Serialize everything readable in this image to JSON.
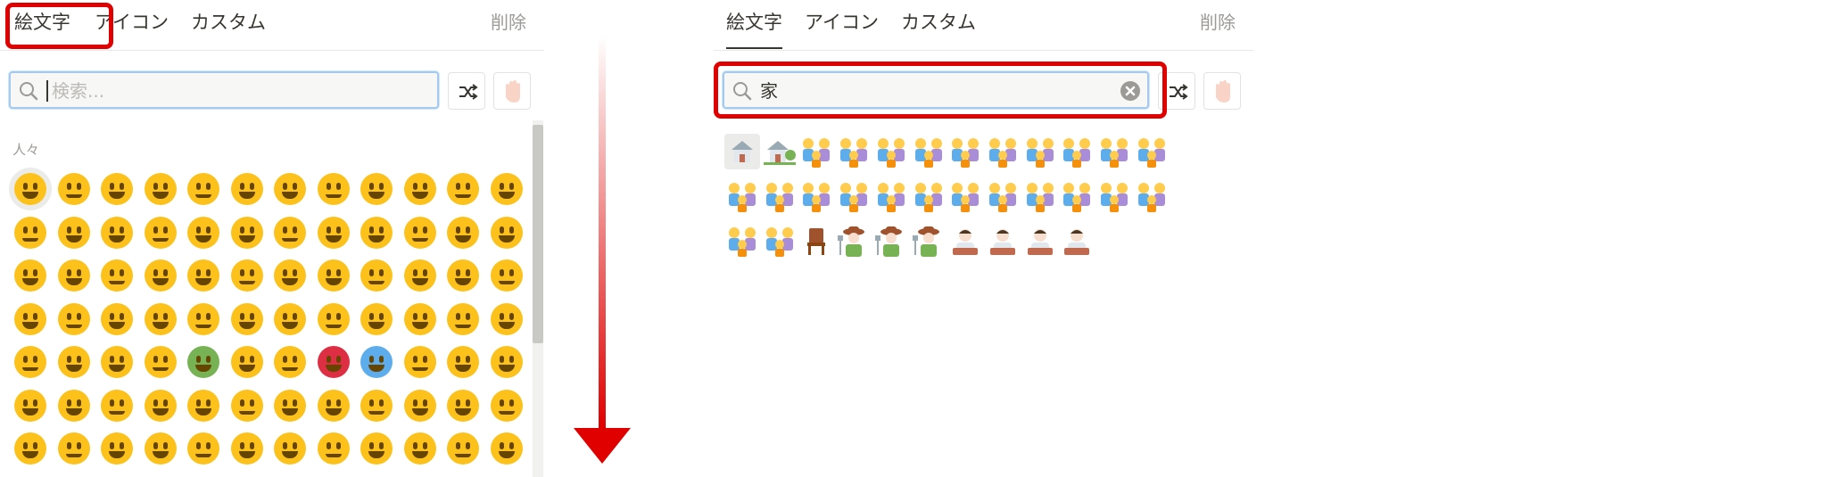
{
  "left": {
    "tabs": [
      {
        "label": "絵文字",
        "active": true
      },
      {
        "label": "アイコン",
        "active": false
      },
      {
        "label": "カスタム",
        "active": false
      }
    ],
    "remove_label": "削除",
    "search_placeholder": "検索...",
    "section_label": "人々",
    "emoji_rows": 7,
    "emoji_cols": 12
  },
  "right": {
    "tabs": [
      {
        "label": "絵文字",
        "active": true
      },
      {
        "label": "アイコン",
        "active": false
      },
      {
        "label": "カスタム",
        "active": false
      }
    ],
    "remove_label": "削除",
    "search_value": "家",
    "result_count": 34
  },
  "colors": {
    "highlight": "#e00000",
    "arrow": "#e00000",
    "emoji_yellow": "#fcc21b"
  },
  "icons": [
    "search-icon",
    "shuffle-icon",
    "skin-tone-hand-icon",
    "clear-icon",
    "down-arrow-icon"
  ]
}
